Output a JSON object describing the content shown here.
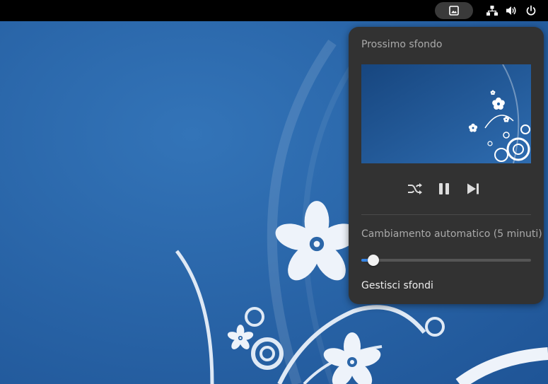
{
  "topbar": {
    "indicators": [
      {
        "id": "wallpaper",
        "icon": "image-icon"
      },
      {
        "id": "network",
        "icon": "network-wired-icon"
      },
      {
        "id": "volume",
        "icon": "volume-icon"
      },
      {
        "id": "power",
        "icon": "power-icon"
      }
    ]
  },
  "popup": {
    "title": "Prossimo sfondo",
    "controls": [
      "shuffle-icon",
      "pause-icon",
      "skip-next-icon"
    ],
    "auto_change_label": "Cambiamento automatico (5 minuti)",
    "slider_value": 0.07,
    "manage_label": "Gestisci sfondi"
  },
  "colors": {
    "wallpaper_blue": "#2b66a8",
    "popup_bg": "#323232",
    "accent": "#3584e4"
  }
}
